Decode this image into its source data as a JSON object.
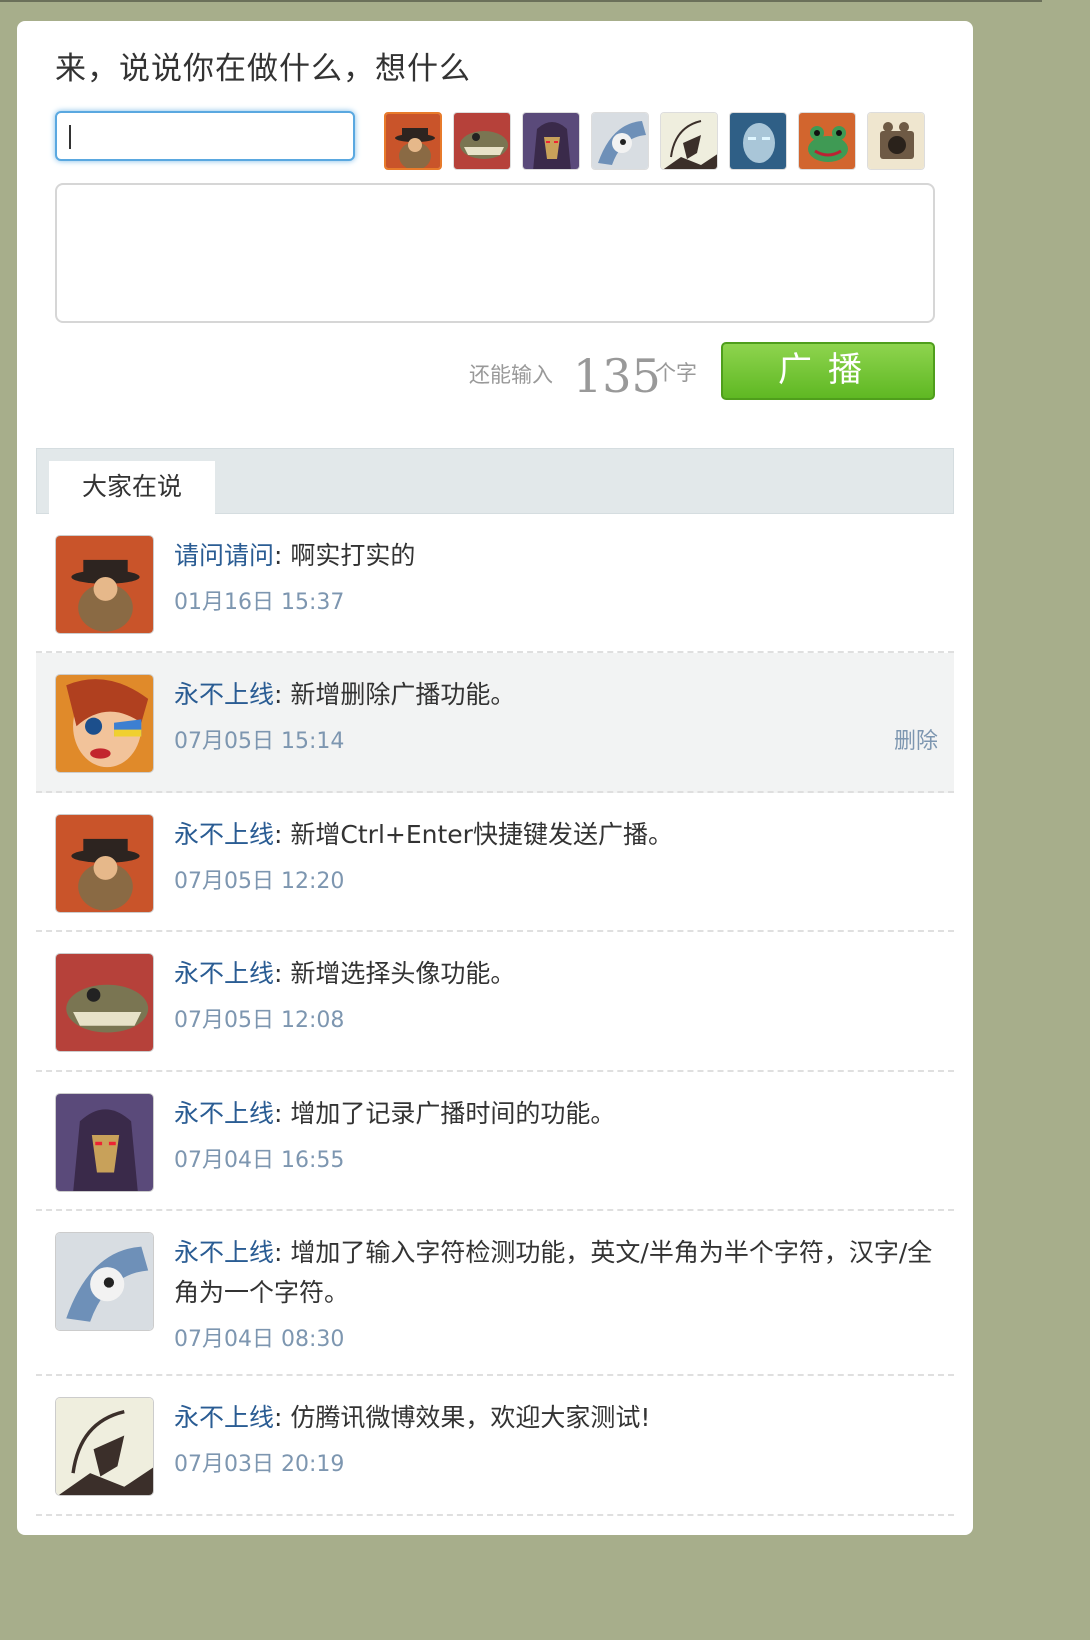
{
  "composer": {
    "heading": "来，说说你在做什么，想什么",
    "name_value": "",
    "message_value": "",
    "counter_prefix": "还能输入",
    "counter_value": "135",
    "counter_suffix": "个字",
    "send_label": "广播",
    "avatar_icons": [
      "avatar-hat-man-icon",
      "avatar-croc-icon",
      "avatar-hooded-icon",
      "avatar-bird-icon",
      "avatar-archer-icon",
      "avatar-robot-icon",
      "avatar-frog-icon",
      "avatar-camera-icon"
    ],
    "selected_avatar": "avatar-hat-man-icon"
  },
  "tabs": [
    {
      "label": "大家在说"
    }
  ],
  "feed": [
    {
      "avatar": "avatar-hat-man-icon",
      "author": "请问请问",
      "sep": ":",
      "text": "啊实打实的",
      "time": "01月16日 15:37"
    },
    {
      "avatar": "avatar-girl-icon",
      "author": "永不上线",
      "sep": ":",
      "text": "新增删除广播功能。",
      "time": "07月05日 15:14",
      "delete_label": "删除"
    },
    {
      "avatar": "avatar-hat-man-icon",
      "author": "永不上线",
      "sep": ":",
      "text": "新增Ctrl+Enter快捷键发送广播。",
      "time": "07月05日 12:20"
    },
    {
      "avatar": "avatar-croc-icon",
      "author": "永不上线",
      "sep": ":",
      "text": "新增选择头像功能。",
      "time": "07月05日 12:08"
    },
    {
      "avatar": "avatar-hooded-icon",
      "author": "永不上线",
      "sep": ":",
      "text": "增加了记录广播时间的功能。",
      "time": "07月04日 16:55"
    },
    {
      "avatar": "avatar-bird-icon",
      "author": "永不上线",
      "sep": ":",
      "text": "增加了输入字符检测功能，英文/半角为半个字符，汉字/全角为一个字符。",
      "time": "07月04日 08:30"
    },
    {
      "avatar": "avatar-archer-icon",
      "author": "永不上线",
      "sep": ":",
      "text": "仿腾讯微博效果，欢迎大家测试!",
      "time": "07月03日 20:19"
    }
  ]
}
